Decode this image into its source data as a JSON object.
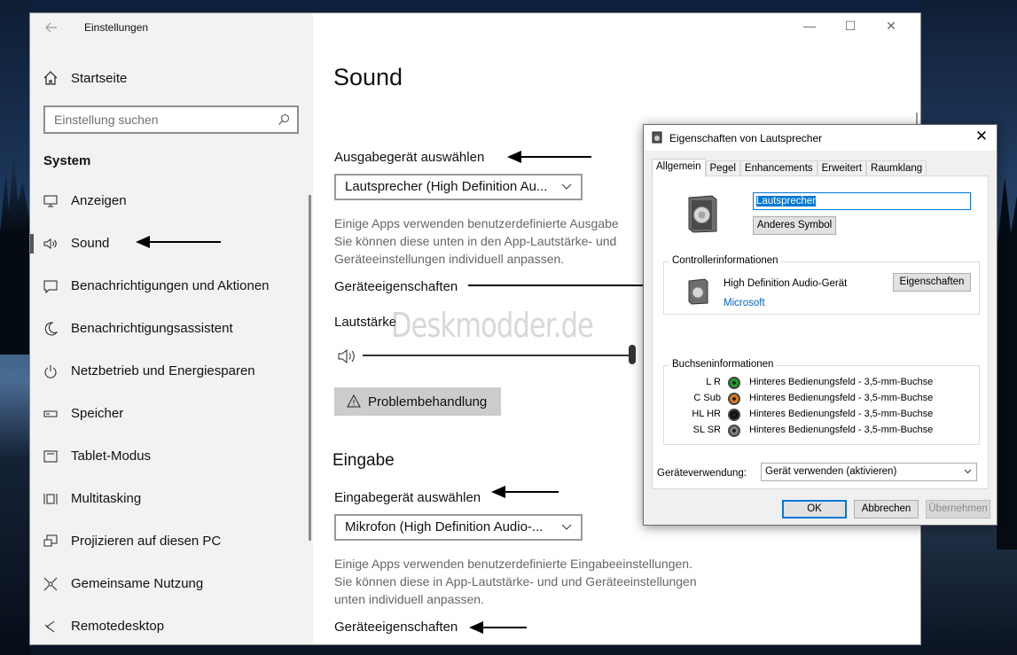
{
  "settings": {
    "app_title": "Einstellungen",
    "home_label": "Startseite",
    "search_placeholder": "Einstellung suchen",
    "section_header": "System",
    "nav_items": [
      {
        "label": "Anzeigen",
        "icon": "monitor-icon"
      },
      {
        "label": "Sound",
        "icon": "speaker-icon",
        "active": true
      },
      {
        "label": "Benachrichtigungen und Aktionen",
        "icon": "notification-icon"
      },
      {
        "label": "Benachrichtigungsassistent",
        "icon": "moon-icon"
      },
      {
        "label": "Netzbetrieb und Energiesparen",
        "icon": "power-icon"
      },
      {
        "label": "Speicher",
        "icon": "storage-icon"
      },
      {
        "label": "Tablet-Modus",
        "icon": "tablet-icon"
      },
      {
        "label": "Multitasking",
        "icon": "multitasking-icon"
      },
      {
        "label": "Projizieren auf diesen PC",
        "icon": "project-icon"
      },
      {
        "label": "Gemeinsame Nutzung",
        "icon": "share-icon"
      },
      {
        "label": "Remotedesktop",
        "icon": "remote-icon"
      }
    ]
  },
  "content": {
    "page_title": "Sound",
    "output_label": "Ausgabegerät auswählen",
    "output_device": "Lautsprecher (High Definition Au...",
    "output_desc_1": "Einige Apps verwenden benutzerdefinierte Ausgabe",
    "output_desc_2": "Sie können diese unten in den App-Lautstärke- und",
    "output_desc_3": "Geräteeinstellungen individuell anpassen.",
    "device_props_link": "Geräteeigenschaften",
    "volume_label": "Lautstärke",
    "volume_level": 1.0,
    "troubleshoot_label": "Problembehandlung",
    "input_heading": "Eingabe",
    "input_label": "Eingabegerät auswählen",
    "input_device": "Mikrofon (High Definition Audio-...",
    "input_desc_1": "Einige Apps verwenden benutzerdefinierte Eingabeeinstellungen.",
    "input_desc_2": "Sie können diese in App-Lautstärke- und und Geräteeinstellungen",
    "input_desc_3": "unten individuell anpassen.",
    "input_props_link": "Geräteeigenschaften",
    "watermark": "Deskmodder.de"
  },
  "dialog": {
    "title": "Eigenschaften von Lautsprecher",
    "tabs": [
      "Allgemein",
      "Pegel",
      "Enhancements",
      "Erweitert",
      "Raumklang"
    ],
    "active_tab": "Allgemein",
    "device_name": "Lautsprecher",
    "change_icon_button": "Anderes Symbol",
    "controller_group_title": "Controllerinformationen",
    "controller_name": "High Definition Audio-Gerät",
    "controller_vendor": "Microsoft",
    "properties_button": "Eigenschaften",
    "jack_group_title": "Buchseninformationen",
    "jacks": [
      {
        "channel": "L R",
        "color": "#1aa31a",
        "description": "Hinteres Bedienungsfeld - 3,5-mm-Buchse"
      },
      {
        "channel": "C Sub",
        "color": "#e07a1a",
        "description": "Hinteres Bedienungsfeld - 3,5-mm-Buchse"
      },
      {
        "channel": "HL HR",
        "color": "#111111",
        "description": "Hinteres Bedienungsfeld - 3,5-mm-Buchse"
      },
      {
        "channel": "SL SR",
        "color": "#808080",
        "description": "Hinteres Bedienungsfeld - 3,5-mm-Buchse"
      }
    ],
    "usage_label": "Geräteverwendung:",
    "usage_value": "Gerät verwenden (aktivieren)",
    "ok_button": "OK",
    "cancel_button": "Abbrechen",
    "apply_button": "Übernehmen"
  },
  "colors": {
    "sidebar_bg": "#f2f2f2",
    "link_blue": "#0066cc",
    "accent": "#0078d7"
  }
}
